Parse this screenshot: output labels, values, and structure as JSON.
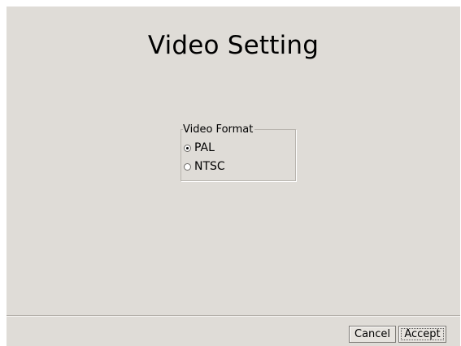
{
  "title": "Video Setting",
  "video_format": {
    "legend": "Video Format",
    "options": [
      {
        "label": "PAL",
        "selected": true
      },
      {
        "label": "NTSC",
        "selected": false
      }
    ]
  },
  "buttons": {
    "cancel_label": "Cancel",
    "accept_label": "Accept"
  },
  "colors": {
    "background": "#dfdcd7"
  }
}
